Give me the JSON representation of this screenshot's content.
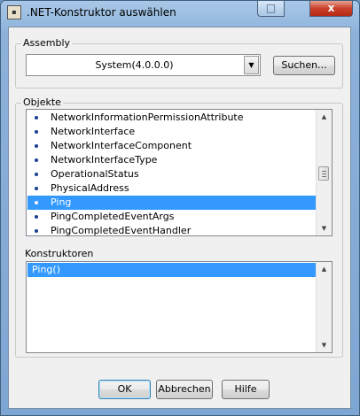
{
  "window": {
    "title": ".NET-Konstruktor auswählen",
    "icon": "labview-app-icon",
    "maximize_glyph": "□",
    "close_glyph": "x"
  },
  "assembly": {
    "label": "Assembly",
    "selected": "System(4.0.0.0)",
    "dropdown_glyph": "▼",
    "search_button": "Suchen..."
  },
  "objects": {
    "label": "Objekte",
    "items": [
      {
        "label": "NetworkInformationPermissionAttribute",
        "selected": false
      },
      {
        "label": "NetworkInterface",
        "selected": false
      },
      {
        "label": "NetworkInterfaceComponent",
        "selected": false
      },
      {
        "label": "NetworkInterfaceType",
        "selected": false
      },
      {
        "label": "OperationalStatus",
        "selected": false
      },
      {
        "label": "PhysicalAddress",
        "selected": false
      },
      {
        "label": "Ping",
        "selected": true
      },
      {
        "label": "PingCompletedEventArgs",
        "selected": false
      },
      {
        "label": "PingCompletedEventHandler",
        "selected": false
      }
    ],
    "scroll_up": "▲",
    "scroll_down": "▼"
  },
  "constructors": {
    "label": "Konstruktoren",
    "items": [
      {
        "label": "Ping()",
        "selected": true
      }
    ],
    "scroll_up": "▲",
    "scroll_down": "▼"
  },
  "footer": {
    "ok": "OK",
    "cancel": "Abbrechen",
    "help": "Hilfe"
  },
  "colors": {
    "selection": "#3399ff",
    "frame": "#8cb2da",
    "close": "#c8412c"
  }
}
